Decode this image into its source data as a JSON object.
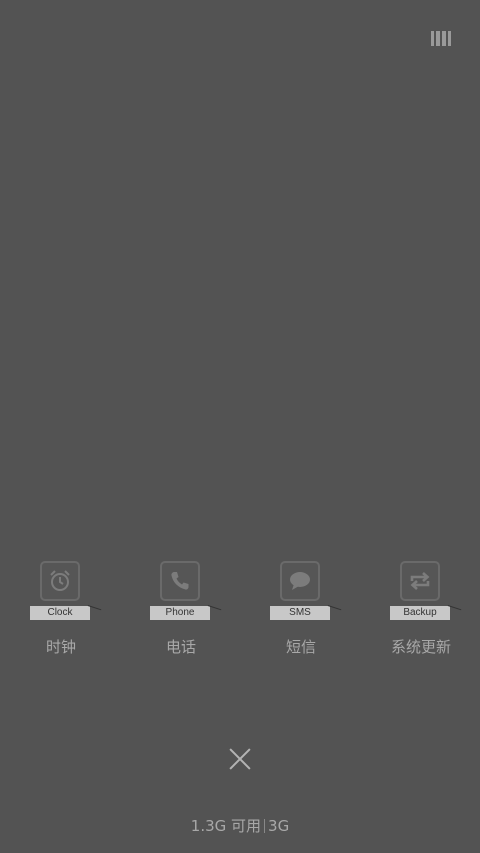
{
  "top_bar": {
    "icon": "stacked-cards-icon"
  },
  "apps": [
    {
      "icon": "alarm-clock-icon",
      "tag": "Clock",
      "label": "时钟"
    },
    {
      "icon": "phone-icon",
      "tag": "Phone",
      "label": "电话"
    },
    {
      "icon": "chat-bubble-icon",
      "tag": "SMS",
      "label": "短信"
    },
    {
      "icon": "sync-arrows-icon",
      "tag": "Backup",
      "label": "系统更新"
    }
  ],
  "close": {
    "icon": "close-icon"
  },
  "memory": {
    "available": "1.3G 可用",
    "total": "3G"
  },
  "colors": {
    "background": "#535353",
    "text": "#a8a8a8",
    "tag_bg": "#c8c8c8"
  }
}
